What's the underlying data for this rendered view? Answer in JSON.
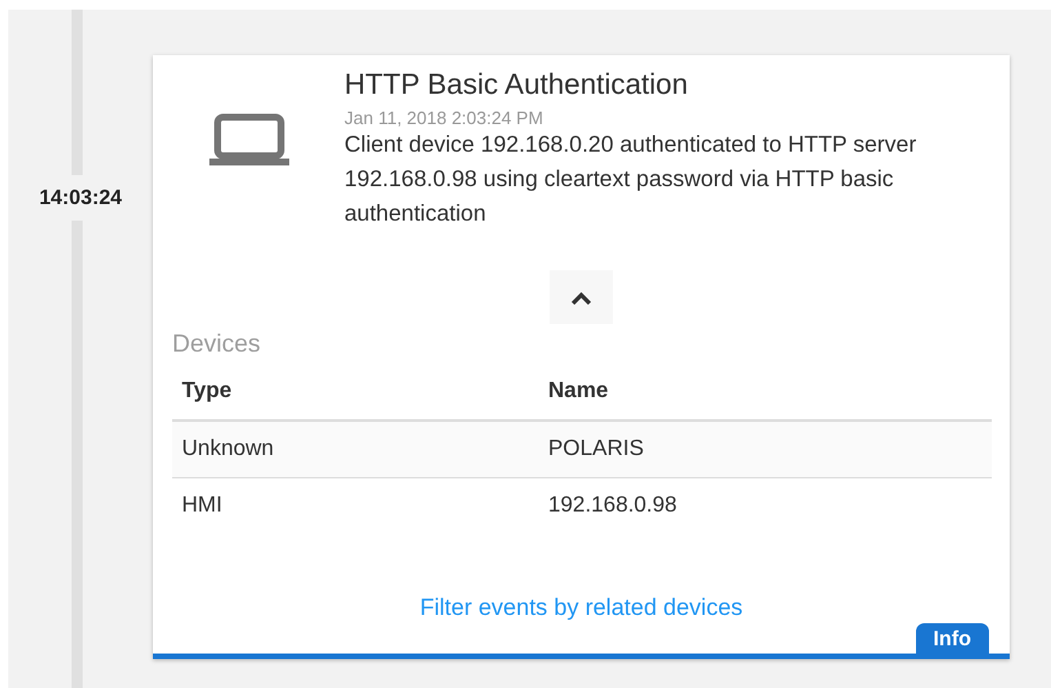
{
  "timeline": {
    "time": "14:03:24"
  },
  "event": {
    "title": "HTTP Basic Authentication",
    "timestamp": "Jan 11, 2018 2:03:24 PM",
    "description": "Client device 192.168.0.20 authenticated to HTTP server 192.168.0.98 using cleartext password via HTTP basic authentication",
    "expanded": true
  },
  "devices": {
    "heading": "Devices",
    "columns": [
      "Type",
      "Name"
    ],
    "rows": [
      [
        "Unknown",
        "POLARIS"
      ],
      [
        "HMI",
        "192.168.0.98"
      ]
    ]
  },
  "link": "Filter events by related devices",
  "severity": {
    "label": "Info"
  }
}
